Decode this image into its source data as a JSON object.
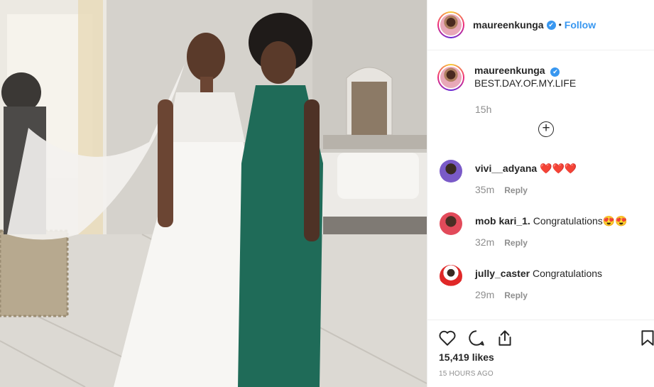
{
  "post": {
    "username": "maureenkunga",
    "verified_mark": "✔",
    "separator": "•",
    "follow_label": "Follow",
    "caption": "BEST.DAY.OF.MY.LIFE",
    "time_ago": "15h",
    "load_more_icon": "plus-circle-icon",
    "likes": "15,419 likes",
    "posted": "15 HOURS AGO"
  },
  "comments": [
    {
      "user": "vivi__adyana",
      "body": " ❤️❤️❤️",
      "age": "35m",
      "reply": "Reply"
    },
    {
      "user": "mob kari_1.",
      "body": " Congratulations😍😍",
      "age": "32m",
      "reply": "Reply"
    },
    {
      "user": "jully_caster",
      "body": " Congratulations",
      "age": "29m",
      "reply": "Reply"
    }
  ],
  "icons": {
    "like": "heart-icon",
    "comment": "comment-bubble-icon",
    "share": "share-icon",
    "save": "bookmark-icon"
  },
  "colors": {
    "link_blue": "#3897f0",
    "muted": "#8e8e8e",
    "text": "#262626"
  }
}
